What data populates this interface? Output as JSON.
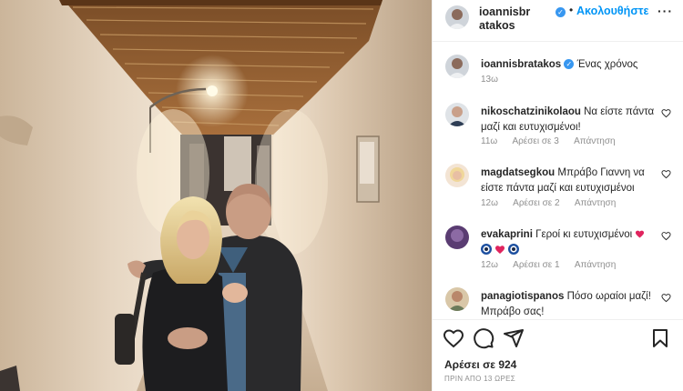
{
  "post": {
    "author": "ioannisbratakos",
    "follow_label": "Ακολουθήστε",
    "separator": "•",
    "more_label": "···",
    "caption": "Ένας χρόνος",
    "caption_time": "13ω",
    "likes": "Αρέσει σε 924",
    "posted_ago": "ΠΡΙΝ ΑΠΟ 13 ΩΡΕΣ"
  },
  "comments": [
    {
      "user": "nikoschatzinikolaou",
      "text": "Να είστε πάντα μαζί και ευτυχισμένοι!",
      "time": "11ω",
      "likes": "Αρέσει σε 3",
      "reply": "Απάντηση"
    },
    {
      "user": "magdatsegkou",
      "text": "Μπράβο Γιαννη να είστε πάντα μαζί και ευτυχισμένοι",
      "time": "12ω",
      "likes": "Αρέσει σε 2",
      "reply": "Απάντηση"
    },
    {
      "user": "evakaprini",
      "text": "Γεροί κι ευτυχισμένοι",
      "time": "12ω",
      "likes": "Αρέσει σε 1",
      "reply": "Απάντηση"
    },
    {
      "user": "panagiotispanos",
      "text": "Πόσο ωραίοι μαζί! Μπράβο σας!",
      "time": "",
      "likes": "",
      "reply": ""
    }
  ],
  "colors": {
    "link": "#0095f6",
    "verified": "#3897f0",
    "meta": "#8e8e8e",
    "text": "#262626"
  },
  "icons": [
    "heart-icon",
    "comment-icon",
    "share-icon",
    "bookmark-icon",
    "verified-icon",
    "more-icon"
  ]
}
